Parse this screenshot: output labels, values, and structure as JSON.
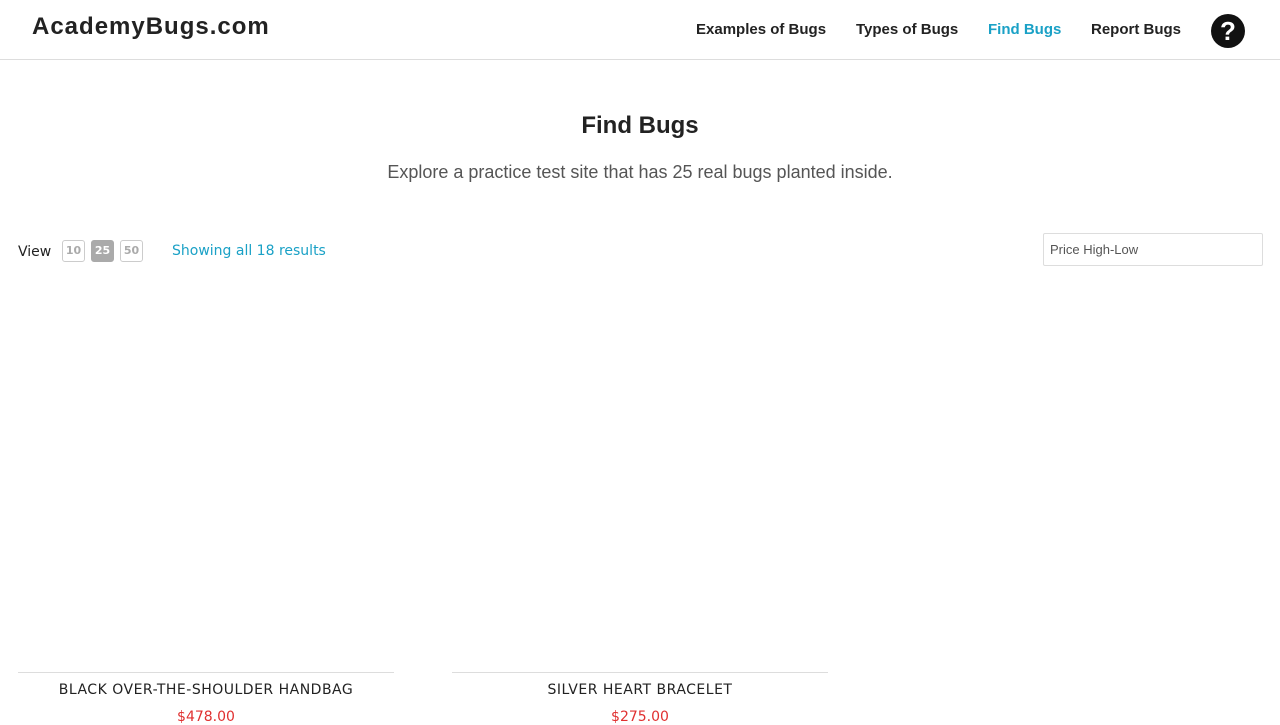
{
  "header": {
    "logo": "AcademyBugs.com",
    "nav": [
      {
        "label": "Examples of Bugs",
        "active": false
      },
      {
        "label": "Types of Bugs",
        "active": false
      },
      {
        "label": "Find Bugs",
        "active": true
      },
      {
        "label": "Report Bugs",
        "active": false
      }
    ],
    "help_icon": "?"
  },
  "main": {
    "title": "Find Bugs",
    "subtitle": "Explore a practice test site that has 25 real bugs planted inside."
  },
  "toolbar": {
    "view_label": "View",
    "view_options": [
      "10",
      "25",
      "50"
    ],
    "view_selected": "25",
    "results_text": "Showing all 18 results",
    "sort_placeholder": "Price High-Low"
  },
  "products": [
    {
      "name": "BLACK OVER-THE-SHOULDER HANDBAG",
      "price": "$478.00"
    },
    {
      "name": "SILVER HEART BRACELET",
      "price": "$275.00"
    }
  ],
  "colors": {
    "accent": "#1aa1c6",
    "price": "#e03030"
  }
}
